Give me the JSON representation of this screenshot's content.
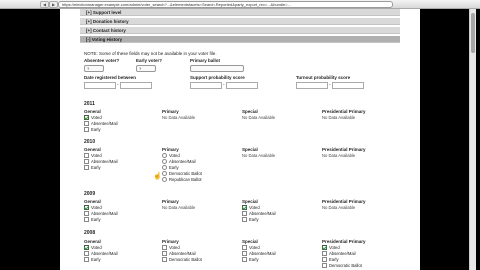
{
  "browser": {
    "url": "https://electionmanager.example.com/admin/voter_search?...&elementsfacets=Search.Reported&party_export_rev=...&bundle=...",
    "back_icon": "arrow-left-icon",
    "forward_icon": "arrow-right-icon"
  },
  "sections": [
    {
      "label": "[+] Support level",
      "active": false
    },
    {
      "label": "[+] Donation history",
      "active": false
    },
    {
      "label": "[+] Contact history",
      "active": false
    },
    {
      "label": "[-] Voting History",
      "active": true
    }
  ],
  "note": "NOTE: Some of these fields may not be available in your voter file.",
  "filters": {
    "absentee_label": "Absentee voter?",
    "absentee_value": "?",
    "early_label": "Early voter?",
    "early_value": "?",
    "primary_ballot_label": "Primary ballot",
    "primary_ballot_value": "",
    "date_registered_label": "Date registered between",
    "support_label": "Support probability score",
    "turnout_label": "Turnout probability score"
  },
  "columns": {
    "general": "General",
    "primary": "Primary",
    "special": "Special",
    "presidential": "Presidential Primary"
  },
  "no_data": "No Data Available",
  "years": [
    {
      "year": "2011",
      "general": [
        "Voted",
        "Absentee/Mail",
        "Early"
      ],
      "primary": null,
      "special": null,
      "presidential": null
    },
    {
      "year": "2010",
      "general": [
        "Voted",
        "Absentee/Mail",
        "Early"
      ],
      "primary": [
        "Voted",
        "Absentee/Mail",
        "Early",
        "Democratic Ballot",
        "Republican Ballot"
      ],
      "special": null,
      "presidential": null
    },
    {
      "year": "2009",
      "general": [
        "Voted",
        "Absentee/Mail",
        "Early"
      ],
      "primary": null,
      "special": [
        "Voted",
        "Absentee/Mail",
        "Early"
      ],
      "presidential": null
    },
    {
      "year": "2008",
      "general": [
        "Voted",
        "Absentee/Mail",
        "Early"
      ],
      "primary": [
        "Voted",
        "Absentee/Mail",
        "Democratic Ballot"
      ],
      "special": [
        "Voted",
        "Absentee/Mail",
        "Early"
      ],
      "presidential": [
        "Voted",
        "Absentee/Mail",
        "Early",
        "Democratic Ballot"
      ]
    }
  ]
}
